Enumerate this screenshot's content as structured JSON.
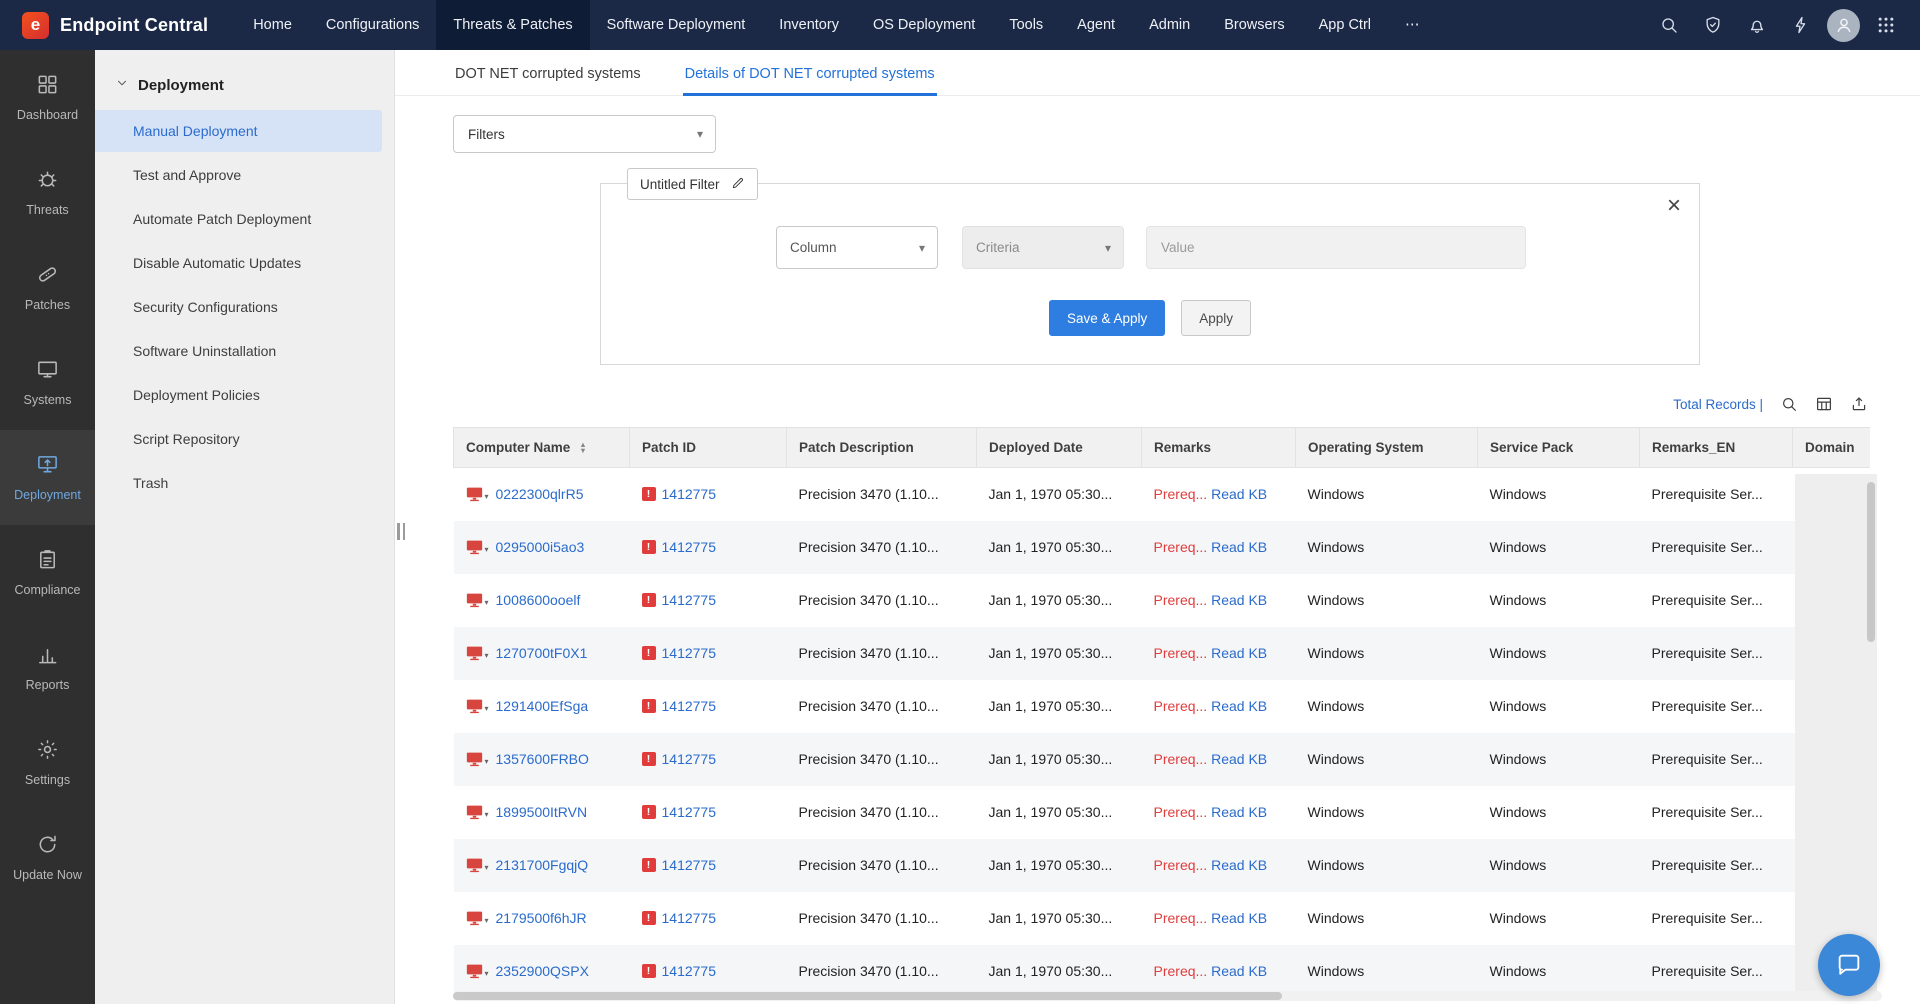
{
  "navbar": {
    "brand": "Endpoint Central",
    "brand_mark_text": "e",
    "items": [
      {
        "label": "Home",
        "active": false
      },
      {
        "label": "Configurations",
        "active": false
      },
      {
        "label": "Threats & Patches",
        "active": true
      },
      {
        "label": "Software Deployment",
        "active": false
      },
      {
        "label": "Inventory",
        "active": false
      },
      {
        "label": "OS Deployment",
        "active": false
      },
      {
        "label": "Tools",
        "active": false
      },
      {
        "label": "Agent",
        "active": false
      },
      {
        "label": "Admin",
        "active": false
      },
      {
        "label": "Browsers",
        "active": false
      },
      {
        "label": "App Ctrl",
        "active": false
      },
      {
        "label": "⋯",
        "active": false
      }
    ],
    "icons": [
      {
        "name": "search-icon",
        "icon": "search"
      },
      {
        "name": "security-status-icon",
        "icon": "shield"
      },
      {
        "name": "notifications-icon",
        "icon": "bell"
      },
      {
        "name": "quick-actions-icon",
        "icon": "bolt"
      },
      {
        "name": "user-avatar",
        "icon": "person"
      },
      {
        "name": "apps-grid-icon",
        "icon": "grid"
      }
    ]
  },
  "rail": {
    "items": [
      {
        "label": "Dashboard",
        "icon": "dashboard",
        "active": false
      },
      {
        "label": "Threats",
        "icon": "threats",
        "active": false
      },
      {
        "label": "Patches",
        "icon": "patches",
        "active": false
      },
      {
        "label": "Systems",
        "icon": "systems",
        "active": false
      },
      {
        "label": "Deployment",
        "icon": "deployment",
        "active": true
      },
      {
        "label": "Compliance",
        "icon": "compliance",
        "active": false
      },
      {
        "label": "Reports",
        "icon": "reports",
        "active": false
      },
      {
        "label": "Settings",
        "icon": "settings",
        "active": false
      },
      {
        "label": "Update Now",
        "icon": "update",
        "active": false
      }
    ]
  },
  "sidebar": {
    "section": "Deployment",
    "items": [
      {
        "label": "Manual Deployment",
        "active": true
      },
      {
        "label": "Test and Approve",
        "active": false
      },
      {
        "label": "Automate Patch Deployment",
        "active": false
      },
      {
        "label": "Disable Automatic Updates",
        "active": false
      },
      {
        "label": "Security Configurations",
        "active": false
      },
      {
        "label": "Software Uninstallation",
        "active": false
      },
      {
        "label": "Deployment Policies",
        "active": false
      },
      {
        "label": "Script Repository",
        "active": false
      },
      {
        "label": "Trash",
        "active": false
      }
    ]
  },
  "tabs": [
    {
      "label": "DOT NET corrupted systems",
      "active": false
    },
    {
      "label": "Details of DOT NET corrupted systems",
      "active": true
    }
  ],
  "filters": {
    "dropdown_label": "Filters",
    "panel_title": "Untitled Filter",
    "column_placeholder": "Column",
    "criteria_placeholder": "Criteria",
    "value_placeholder": "Value",
    "save_apply_label": "Save & Apply",
    "apply_label": "Apply"
  },
  "table": {
    "total_records_label": "Total Records |",
    "toolbar_icons": [
      {
        "name": "search-records-icon",
        "icon": "search"
      },
      {
        "name": "column-chooser-icon",
        "icon": "tableIcon"
      },
      {
        "name": "export-icon",
        "icon": "exportIcon"
      }
    ],
    "read_kb_label": "Read KB",
    "columns": [
      {
        "label": "Computer Name",
        "sortable": true
      },
      {
        "label": "Patch ID",
        "sortable": false
      },
      {
        "label": "Patch Description",
        "sortable": false
      },
      {
        "label": "Deployed Date",
        "sortable": false
      },
      {
        "label": "Remarks",
        "sortable": false
      },
      {
        "label": "Operating System",
        "sortable": false
      },
      {
        "label": "Service Pack",
        "sortable": false
      },
      {
        "label": "Remarks_EN",
        "sortable": false
      },
      {
        "label": "Domain",
        "sortable": false
      }
    ],
    "rows": [
      {
        "computer": "0222300qlrR5",
        "patch_id": "1412775",
        "description": "Precision 3470 (1.10...",
        "deployed": "Jan 1, 1970 05:30...",
        "remarks_prefix": "Prereq...",
        "os": "Windows",
        "service_pack": "Windows",
        "remarks_en": "Prerequisite Ser...",
        "domain": ""
      },
      {
        "computer": "0295000i5ao3",
        "patch_id": "1412775",
        "description": "Precision 3470 (1.10...",
        "deployed": "Jan 1, 1970 05:30...",
        "remarks_prefix": "Prereq...",
        "os": "Windows",
        "service_pack": "Windows",
        "remarks_en": "Prerequisite Ser...",
        "domain": ""
      },
      {
        "computer": "1008600ooelf",
        "patch_id": "1412775",
        "description": "Precision 3470 (1.10...",
        "deployed": "Jan 1, 1970 05:30...",
        "remarks_prefix": "Prereq...",
        "os": "Windows",
        "service_pack": "Windows",
        "remarks_en": "Prerequisite Ser...",
        "domain": ""
      },
      {
        "computer": "1270700tF0X1",
        "patch_id": "1412775",
        "description": "Precision 3470 (1.10...",
        "deployed": "Jan 1, 1970 05:30...",
        "remarks_prefix": "Prereq...",
        "os": "Windows",
        "service_pack": "Windows",
        "remarks_en": "Prerequisite Ser...",
        "domain": ""
      },
      {
        "computer": "1291400EfSga",
        "patch_id": "1412775",
        "description": "Precision 3470 (1.10...",
        "deployed": "Jan 1, 1970 05:30...",
        "remarks_prefix": "Prereq...",
        "os": "Windows",
        "service_pack": "Windows",
        "remarks_en": "Prerequisite Ser...",
        "domain": ""
      },
      {
        "computer": "1357600FRBO",
        "patch_id": "1412775",
        "description": "Precision 3470 (1.10...",
        "deployed": "Jan 1, 1970 05:30...",
        "remarks_prefix": "Prereq...",
        "os": "Windows",
        "service_pack": "Windows",
        "remarks_en": "Prerequisite Ser...",
        "domain": ""
      },
      {
        "computer": "1899500ItRVN",
        "patch_id": "1412775",
        "description": "Precision 3470 (1.10...",
        "deployed": "Jan 1, 1970 05:30...",
        "remarks_prefix": "Prereq...",
        "os": "Windows",
        "service_pack": "Windows",
        "remarks_en": "Prerequisite Ser...",
        "domain": ""
      },
      {
        "computer": "2131700FgqjQ",
        "patch_id": "1412775",
        "description": "Precision 3470 (1.10...",
        "deployed": "Jan 1, 1970 05:30...",
        "remarks_prefix": "Prereq...",
        "os": "Windows",
        "service_pack": "Windows",
        "remarks_en": "Prerequisite Ser...",
        "domain": ""
      },
      {
        "computer": "2179500f6hJR",
        "patch_id": "1412775",
        "description": "Precision 3470 (1.10...",
        "deployed": "Jan 1, 1970 05:30...",
        "remarks_prefix": "Prereq...",
        "os": "Windows",
        "service_pack": "Windows",
        "remarks_en": "Prerequisite Ser...",
        "domain": ""
      },
      {
        "computer": "2352900QSPX",
        "patch_id": "1412775",
        "description": "Precision 3470 (1.10...",
        "deployed": "Jan 1, 1970 05:30...",
        "remarks_prefix": "Prereq...",
        "os": "Windows",
        "service_pack": "Windows",
        "remarks_en": "Prerequisite Ser...",
        "domain": ""
      }
    ]
  },
  "colors": {
    "navbar_bg": "#1b2946",
    "navbar_active_bg": "#0f1c36",
    "accent_blue": "#2a6bcc",
    "button_blue": "#2e7de0",
    "alert_red": "#e03c3c",
    "active_sidebar_bg": "#d6e3f7"
  }
}
